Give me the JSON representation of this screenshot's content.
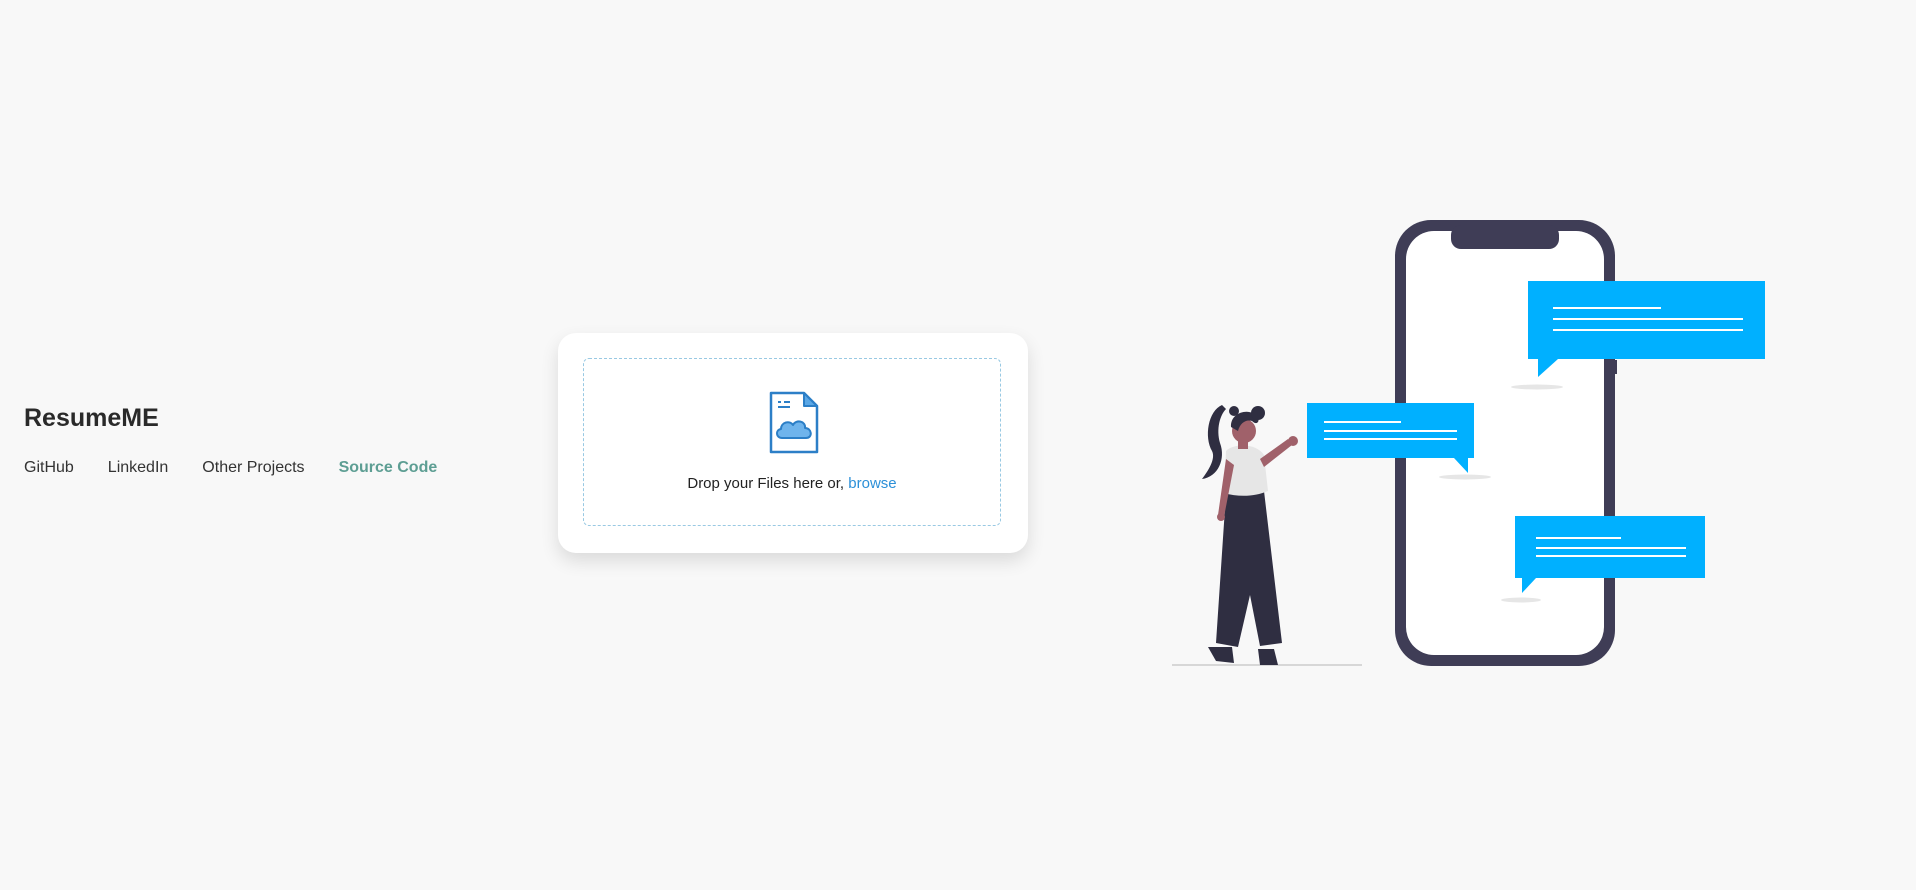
{
  "brand": {
    "title": "ResumeME"
  },
  "nav": {
    "items": [
      {
        "label": "GitHub",
        "active": false
      },
      {
        "label": "LinkedIn",
        "active": false
      },
      {
        "label": "Other Projects",
        "active": false
      },
      {
        "label": "Source Code",
        "active": true
      }
    ]
  },
  "upload": {
    "prompt": "Drop your Files here or,",
    "browse_label": "browse",
    "icon": "file-cloud-icon"
  },
  "colors": {
    "background": "#f8f8f8",
    "accent_nav": "#5d9e93",
    "link": "#2c90d8",
    "bubble": "#00b0ff",
    "phone_frame": "#3f3d56",
    "person_dark": "#2f2e41",
    "skin": "#a0616a"
  },
  "illustration": {
    "name": "woman-with-phone-chat-illustration"
  }
}
